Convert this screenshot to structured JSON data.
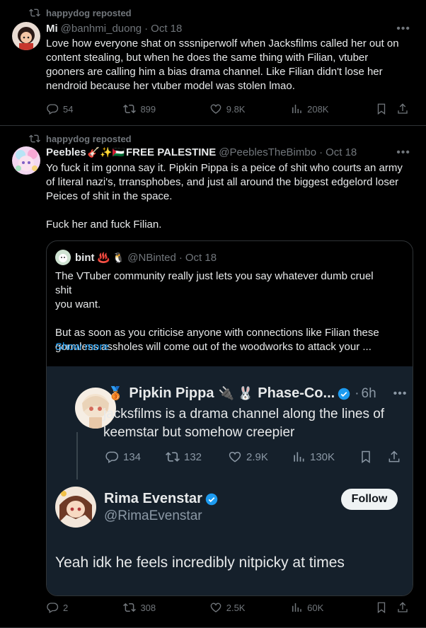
{
  "post1": {
    "repost_label": "happydog reposted",
    "name": "Mi",
    "handle": "@banhmi_duong",
    "dot": "·",
    "time": "Oct 18",
    "text": "Love how everyone shat on sssniperwolf when Jacksfilms called her out on\ncontent stealing, but when he does the same thing with Filian, vtuber\ngooners are calling him a bias drama channel. Like Filian didn't lose her\nnendroid because her vtuber model was stolen lmao.",
    "replies": "54",
    "reposts": "899",
    "likes": "9.8K",
    "views": "208K"
  },
  "post2": {
    "repost_label": "happydog reposted",
    "name": "Peebles",
    "name_emoji": "🎸✨🇵🇸",
    "name_suffix": "FREE PALESTINE",
    "handle": "@PeeblesTheBimbo",
    "dot": "·",
    "time": "Oct 18",
    "text": "Yo fuck it im gonna say it. Pipkin Pippa is a peice of shit who courts an army\nof literal nazi's, trransphobes, and just all around the biggest edgelord loser\nPeices of shit in the space.\n\nFuck her and fuck Filian.",
    "replies": "2",
    "reposts": "308",
    "likes": "2.5K",
    "views": "60K"
  },
  "quote": {
    "name": "bint",
    "name_emoji": "♨️ 🐧",
    "handle": "@NBinted",
    "dot": "·",
    "time": "Oct 18",
    "text": "The VTuber community really just lets you say whatever dumb cruel shit\nyou want.\n\nBut as soon as you criticise anyone with connections like Filian these\ngormless assholes will come out of the woodworks to attack your ...",
    "show_more": "Show more"
  },
  "media": {
    "tweet1": {
      "medal": "🥉",
      "name": "Pipkin Pippa",
      "name_emoji": "🔌 🐰",
      "name_suffix": "Phase-Co...",
      "dot": "·",
      "time": "6h",
      "text": "jacksfilms is a drama channel along the lines of\nkeemstar but somehow creepier",
      "replies": "134",
      "reposts": "132",
      "likes": "2.9K",
      "views": "130K"
    },
    "tweet2": {
      "name": "Rima Evenstar",
      "handle": "@RimaEvenstar",
      "follow_label": "Follow",
      "text": "Yeah idk he feels incredibly nitpicky at times"
    }
  },
  "colors": {
    "accent": "#1d9bf0",
    "muted": "#71767b",
    "bg": "#000000",
    "media_bg": "#15202b"
  }
}
